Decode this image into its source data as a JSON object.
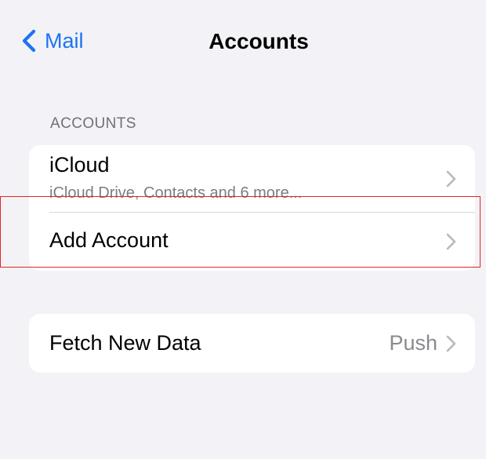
{
  "nav": {
    "back_label": "Mail",
    "title": "Accounts"
  },
  "accounts_section": {
    "header": "ACCOUNTS",
    "rows": [
      {
        "title": "iCloud",
        "subtitle": "iCloud Drive, Contacts and 6 more..."
      },
      {
        "title": "Add Account"
      }
    ]
  },
  "fetch_section": {
    "rows": [
      {
        "title": "Fetch New Data",
        "value": "Push"
      }
    ]
  },
  "colors": {
    "accent": "#1e73f1",
    "background": "#f2f2f7",
    "highlight": "#e32626"
  },
  "icons": {
    "back": "chevron-left-icon",
    "disclosure": "chevron-right-icon"
  }
}
